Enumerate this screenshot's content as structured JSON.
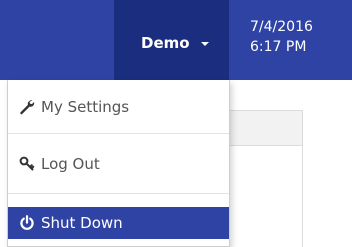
{
  "header": {
    "user_menu": {
      "label": "Demo"
    },
    "date": "7/4/2016",
    "time": "6:17 PM"
  },
  "dropdown": {
    "items": [
      {
        "label": "My Settings",
        "icon": "wrench-icon"
      },
      {
        "label": "Log Out",
        "icon": "key-icon"
      },
      {
        "label": "Shut Down",
        "icon": "power-icon"
      }
    ]
  },
  "colors": {
    "header_bg": "#2f43a5",
    "user_menu_bg": "#1b2d7e",
    "highlight_bg": "#2f43a5",
    "menu_text": "#555555"
  }
}
